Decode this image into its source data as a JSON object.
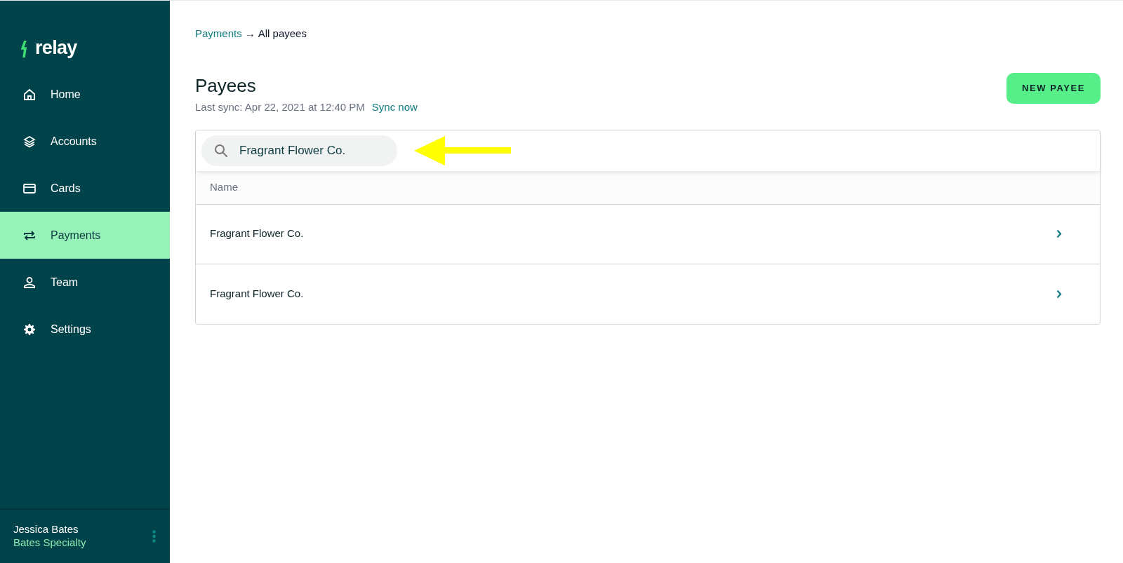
{
  "sidebar": {
    "logo": "relay",
    "items": [
      {
        "label": "Home",
        "selected": false
      },
      {
        "label": "Accounts",
        "selected": false
      },
      {
        "label": "Cards",
        "selected": false
      },
      {
        "label": "Payments",
        "selected": true
      },
      {
        "label": "Team",
        "selected": false
      },
      {
        "label": "Settings",
        "selected": false
      }
    ],
    "user": {
      "name": "Jessica Bates",
      "company": "Bates Specialty"
    }
  },
  "breadcrumb": {
    "parent": "Payments",
    "separator": "→",
    "current": "All payees"
  },
  "header": {
    "title": "Payees",
    "sync_text": "Last sync: Apr 22, 2021 at 12:40 PM",
    "sync_link": "Sync now",
    "button": "NEW PAYEE"
  },
  "search": {
    "value": "Fragrant Flower Co."
  },
  "table": {
    "columns": [
      "Name"
    ],
    "rows": [
      {
        "name": "Fragrant Flower Co."
      },
      {
        "name": "Fragrant Flower Co."
      }
    ]
  }
}
